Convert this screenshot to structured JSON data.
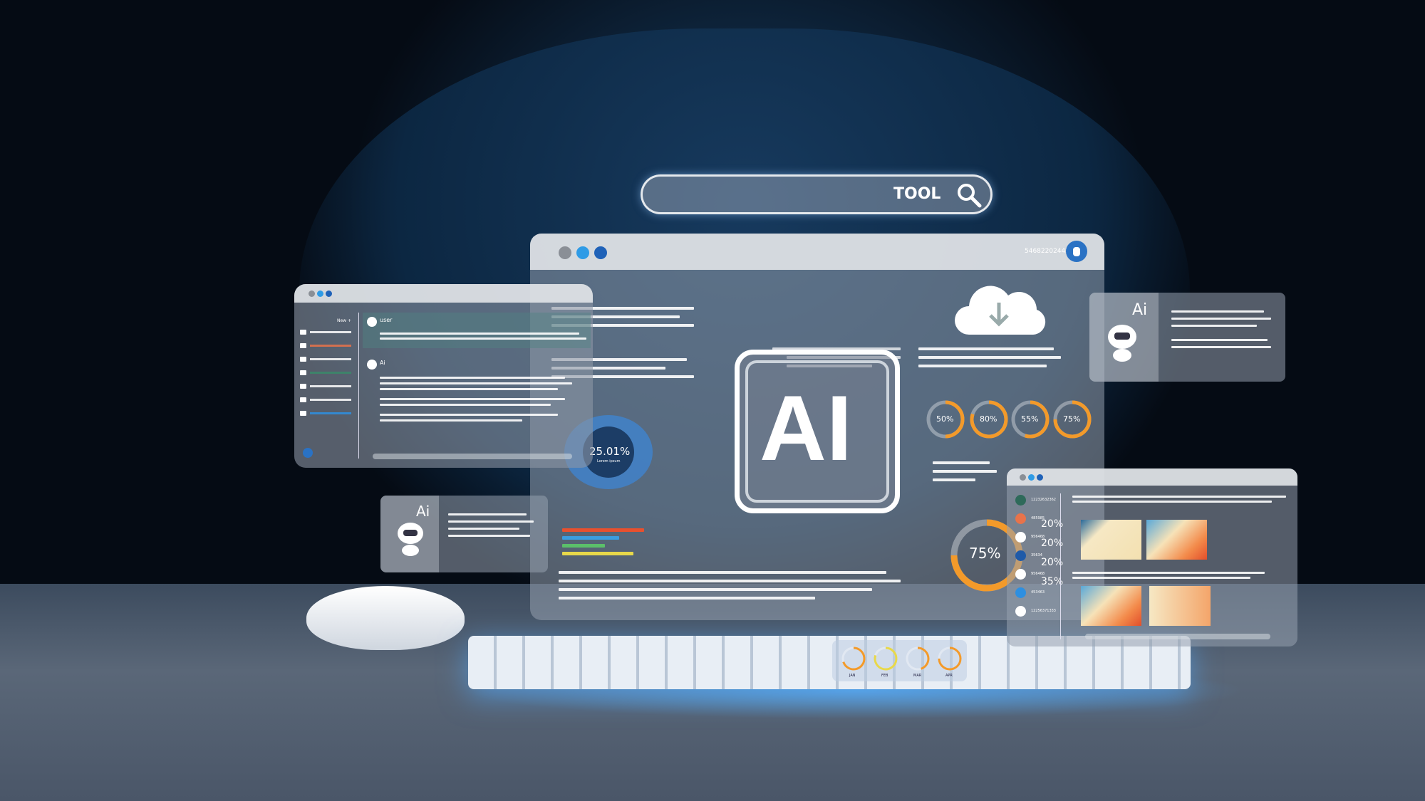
{
  "search": {
    "query": "TOOL",
    "icon": "search-icon"
  },
  "main_window": {
    "account_id": "546822024424",
    "ai_label": "AI",
    "donut_center": {
      "value": "25.01%",
      "caption": "Lorem ipsum",
      "percent": 25.01
    },
    "gauges": [
      {
        "label": "50%",
        "value": 50
      },
      {
        "label": "80%",
        "value": 80
      },
      {
        "label": "55%",
        "value": 55
      },
      {
        "label": "75%",
        "value": 75
      }
    ],
    "big_donut": {
      "label": "75%",
      "value": 75
    },
    "bar_colors": [
      "#e8502e",
      "#3a9de0",
      "#5bbf6a",
      "#e8d84a"
    ]
  },
  "chat_window": {
    "new_label": "New +",
    "user_label": "user",
    "ai_label": "Ai",
    "history_colors": [
      "#ffffff",
      "#e8734a",
      "#ffffff",
      "#3a8a6a",
      "#ffffff",
      "#ffffff",
      "#2e8fe0"
    ]
  },
  "ai_panels": [
    {
      "label": "Ai"
    },
    {
      "label": "Ai"
    }
  ],
  "feed_window": {
    "users": [
      {
        "id": "12232632362",
        "color": "#2e6a5a"
      },
      {
        "id": "485985",
        "color": "#e8734a"
      },
      {
        "id": "956468",
        "color": "#ffffff"
      },
      {
        "id": "35634",
        "color": "#1f5aa8"
      },
      {
        "id": "956468",
        "color": "#ffffff"
      },
      {
        "id": "453463",
        "color": "#2e8fe0"
      },
      {
        "id": "12256371333",
        "color": "#ffffff"
      }
    ],
    "percents": [
      "20%",
      "20%",
      "20%",
      "35%"
    ]
  },
  "months": [
    {
      "label": "JAN"
    },
    {
      "label": "FEB"
    },
    {
      "label": "MAR"
    },
    {
      "label": "APR"
    }
  ],
  "colors": {
    "accent": "#2a72c4",
    "orange": "#f39a2a",
    "red": "#e23a2a",
    "light_blue": "#5ab4e8"
  }
}
